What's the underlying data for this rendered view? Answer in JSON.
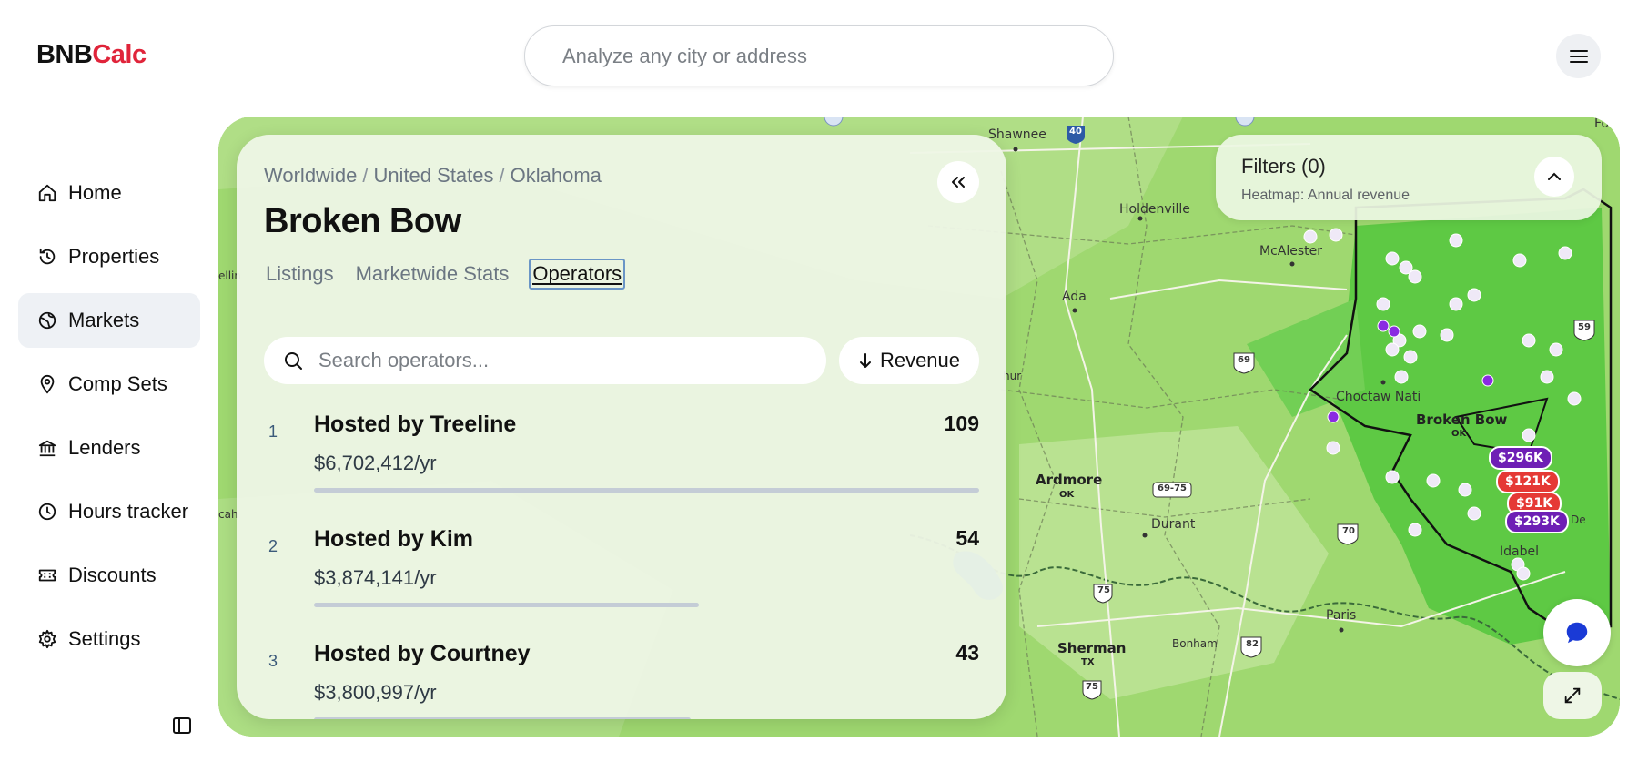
{
  "app": {
    "logo_a": "BNB",
    "logo_b": "Calc"
  },
  "header": {
    "search_placeholder": "Analyze any city or address"
  },
  "sidebar": {
    "items": [
      {
        "label": "Home",
        "icon": "home-icon"
      },
      {
        "label": "Properties",
        "icon": "history-icon"
      },
      {
        "label": "Markets",
        "icon": "globe-icon",
        "active": true
      },
      {
        "label": "Comp Sets",
        "icon": "map-pin-icon"
      },
      {
        "label": "Lenders",
        "icon": "bank-icon"
      },
      {
        "label": "Hours tracker",
        "icon": "clock-icon"
      },
      {
        "label": "Discounts",
        "icon": "ticket-icon"
      },
      {
        "label": "Settings",
        "icon": "gear-icon"
      }
    ]
  },
  "panel": {
    "breadcrumb": [
      "Worldwide",
      "United States",
      "Oklahoma"
    ],
    "separator": "/",
    "title": "Broken Bow",
    "tabs": [
      "Listings",
      "Marketwide Stats",
      "Operators"
    ],
    "active_tab": "Operators",
    "search_placeholder": "Search operators...",
    "sort_label": "Revenue",
    "operators": [
      {
        "rank": "1",
        "name": "Hosted by Treeline",
        "revenue": "$6,702,412/yr",
        "count": "109",
        "share": 1.0
      },
      {
        "rank": "2",
        "name": "Hosted by Kim",
        "revenue": "$3,874,141/yr",
        "count": "54",
        "share": 0.578
      },
      {
        "rank": "3",
        "name": "Hosted by Courtney",
        "revenue": "$3,800,997/yr",
        "count": "43",
        "share": 0.567
      }
    ]
  },
  "filters": {
    "title": "Filters (0)",
    "subtitle": "Heatmap: Annual revenue"
  },
  "map": {
    "labels": {
      "shawnee": "Shawnee",
      "holdenville": "Holdenville",
      "mcalester": "McAlester",
      "ada": "Ada",
      "choctaw": "Choctaw Nati",
      "broken_bow": "Broken Bow",
      "broken_bow_state": "OK",
      "ardmore": "Ardmore",
      "ardmore_state": "OK",
      "durant": "Durant",
      "idabel": "Idabel",
      "paris": "Paris",
      "sherman": "Sherman",
      "sherman_state": "TX",
      "bonham": "Bonham",
      "fort": "Fo",
      "ellin": "ellin",
      "cah": "cah",
      "hur": "hur",
      "de": "De"
    },
    "shields": [
      "40",
      "69",
      "59",
      "69-75",
      "70",
      "75",
      "82",
      "75"
    ],
    "price_pins": [
      {
        "label": "$296K",
        "color": "purple"
      },
      {
        "label": "$121K",
        "color": "red"
      },
      {
        "label": "$91K",
        "color": "red"
      },
      {
        "label": "$293K",
        "color": "purple"
      }
    ],
    "colors": {
      "map_green": "#9fd870",
      "dark_green": "#5ec944",
      "boundary": "#111111",
      "water": "#3a8fd6"
    }
  },
  "colors": {
    "brand_red": "#e0243a",
    "active_nav_bg": "#eef1f5",
    "chat_icon": "#1a3ad6"
  }
}
